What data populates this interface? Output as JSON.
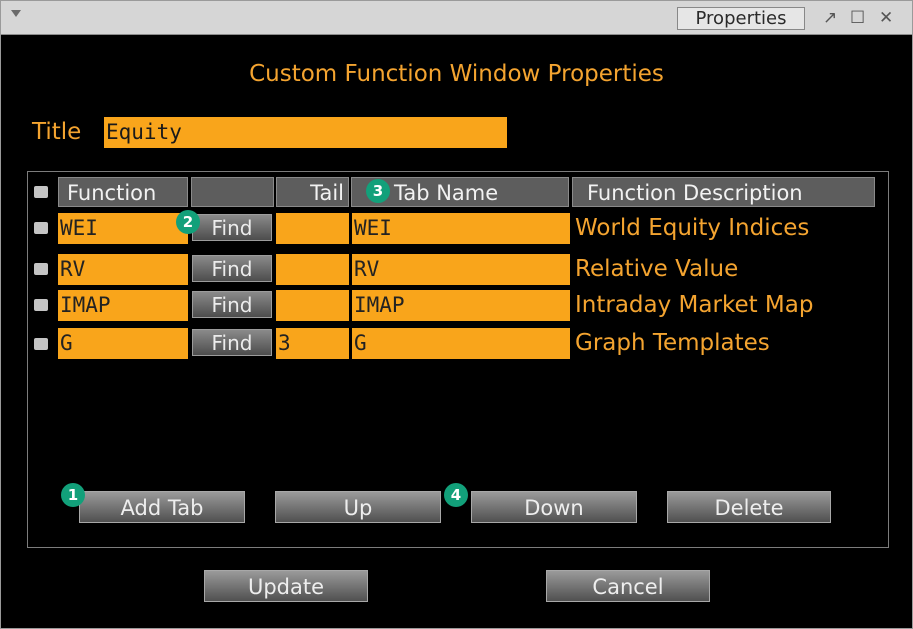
{
  "titlebar": {
    "tab_label": "Properties",
    "controls": [
      "↗",
      "☐",
      "✕"
    ]
  },
  "dialog": {
    "heading": "Custom Function Window Properties",
    "title_label": "Title",
    "title_value": "Equity"
  },
  "grid": {
    "columns": [
      "Function",
      "",
      "Tail",
      "Tab Name",
      "Function Description"
    ],
    "rows": [
      {
        "function": "WEI",
        "find": "Find",
        "tail": "",
        "tab_name": "WEI",
        "description": "World Equity Indices"
      },
      {
        "function": "RV",
        "find": "Find",
        "tail": "",
        "tab_name": "RV",
        "description": "Relative Value"
      },
      {
        "function": "IMAP",
        "find": "Find",
        "tail": "",
        "tab_name": "IMAP",
        "description": "Intraday Market Map"
      },
      {
        "function": "G",
        "find": "Find",
        "tail": "3",
        "tab_name": "G",
        "description": "Graph Templates"
      }
    ]
  },
  "buttons": {
    "add_tab": "Add Tab",
    "up": "Up",
    "down": "Down",
    "delete": "Delete",
    "update": "Update",
    "cancel": "Cancel"
  },
  "callouts": {
    "c1": "1",
    "c2": "2",
    "c3": "3",
    "c4": "4"
  },
  "colors": {
    "accent": "#f9a51b",
    "background": "#000000",
    "callout": "#12a07a"
  }
}
